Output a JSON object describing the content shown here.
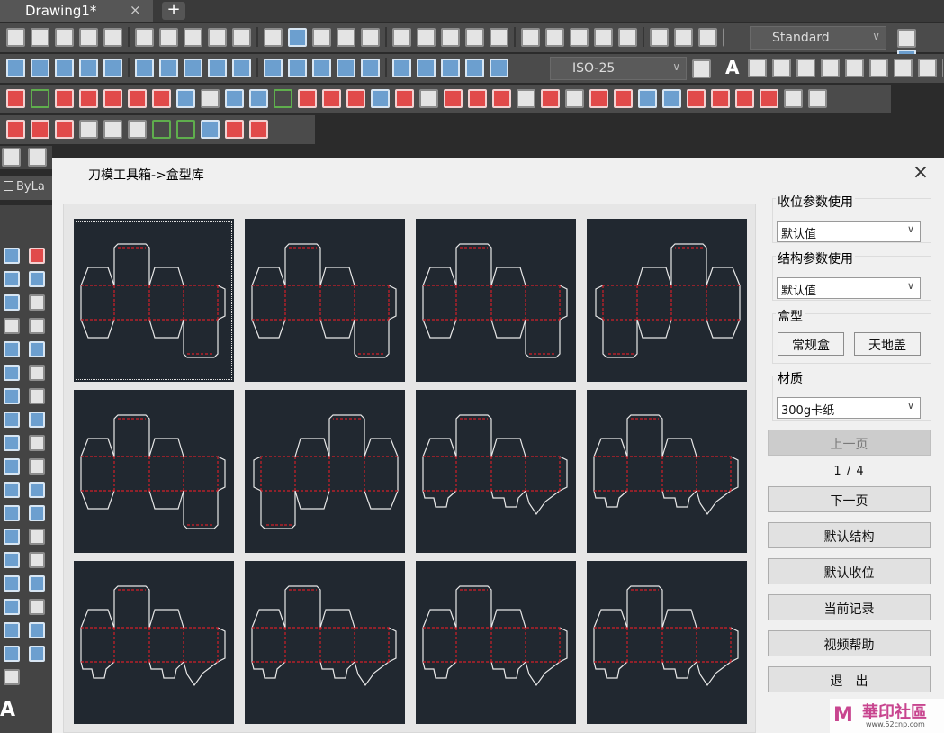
{
  "app": {
    "doc_tab": "Drawing1*",
    "doc_tab_close": "×",
    "new_tab": "+"
  },
  "toolbar": {
    "text_style": "Standard",
    "dim_style": "ISO-25",
    "text_a": "A",
    "bylayer": "ByLa"
  },
  "left_tools": {
    "text_a": "A"
  },
  "dialog": {
    "title": "刀模工具箱->盒型库",
    "close": "×",
    "gallery": {
      "selected_index": 0,
      "tiles": [
        {
          "name": "tuck-end-box-1"
        },
        {
          "name": "tuck-end-box-2"
        },
        {
          "name": "tuck-end-box-3"
        },
        {
          "name": "tuck-end-box-4"
        },
        {
          "name": "tuck-end-box-5"
        },
        {
          "name": "tuck-end-box-6"
        },
        {
          "name": "lock-bottom-box-1"
        },
        {
          "name": "lock-bottom-box-2"
        },
        {
          "name": "lock-bottom-box-3"
        },
        {
          "name": "lock-bottom-box-4"
        },
        {
          "name": "lock-bottom-box-5"
        },
        {
          "name": "lock-bottom-box-6"
        }
      ]
    },
    "side": {
      "layout_params_label": "收位参数使用",
      "layout_params_value": "默认值",
      "struct_params_label": "结构参数使用",
      "struct_params_value": "默认值",
      "box_type_label": "盒型",
      "box_type_regular": "常规盒",
      "box_type_lid": "天地盖",
      "material_label": "材质",
      "material_value": "300g卡纸",
      "prev_page": "上一页",
      "page_indicator": "1 / 4",
      "next_page": "下一页",
      "default_structure": "默认结构",
      "default_layout": "默认收位",
      "current_record": "当前记录",
      "video_help": "视频帮助",
      "exit": "退　出"
    }
  },
  "watermark": {
    "icon": "M",
    "text": "華印社區",
    "url": "www.52cnp.com"
  }
}
